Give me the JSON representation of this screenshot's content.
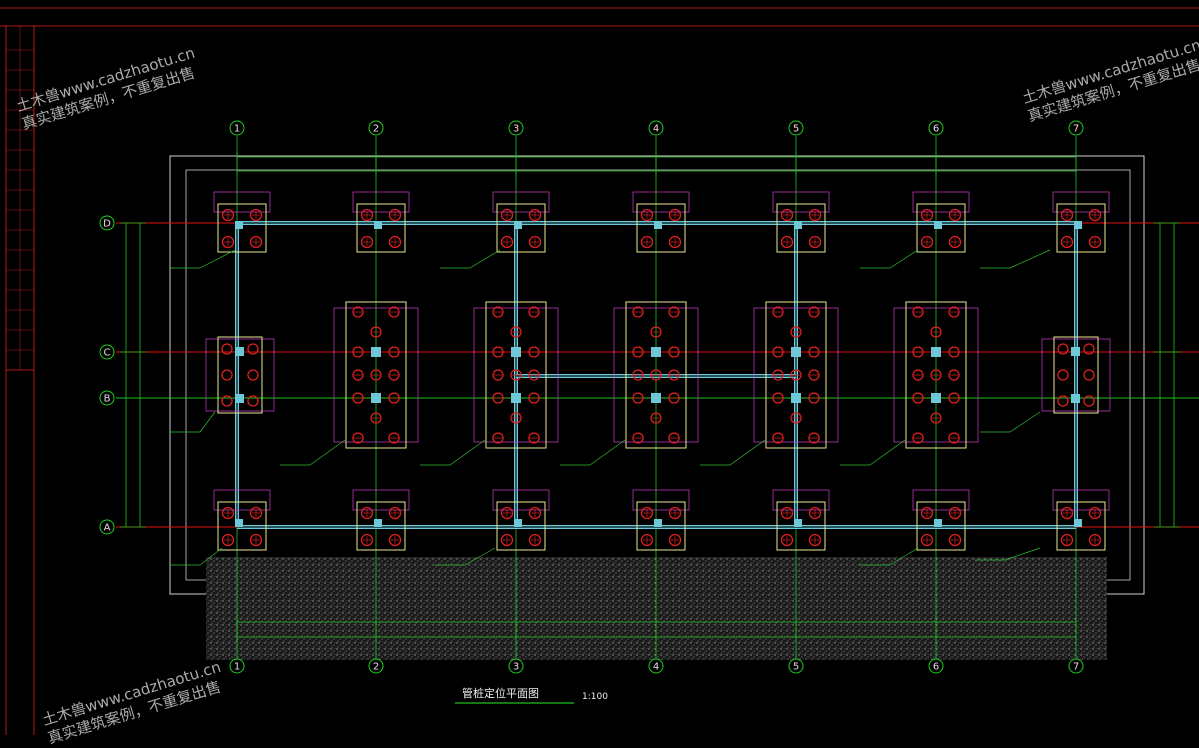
{
  "drawing": {
    "title": "管桩定位平面图",
    "scale": "1:100",
    "axes_numbered": [
      "1",
      "2",
      "3",
      "4",
      "5",
      "6",
      "7"
    ],
    "axes_lettered": [
      "D",
      "C",
      "B",
      "A"
    ]
  },
  "watermarks": [
    {
      "line1": "土木兽www.cadzhaotu.cn",
      "line2": "真实建筑案例，不重复出售"
    },
    {
      "line1": "土木兽www.cadzhaotu.cn",
      "line2": "真实建筑案例，不重复出售"
    },
    {
      "line1": "土木兽www.cadzhaotu.cn",
      "line2": "真实建筑案例，不重复出售"
    }
  ],
  "colors": {
    "background": "#000000",
    "frame": "#b01818",
    "axis_line": "#e01010",
    "axis_bubble": "#20d020",
    "dimension": "#20c020",
    "pile_cap": "#e8e890",
    "pile": "#e02020",
    "beam": "#6ec8d8",
    "tag": "#d040d0",
    "outline": "#d0d0d0",
    "hatch": "#8a8a8a"
  }
}
